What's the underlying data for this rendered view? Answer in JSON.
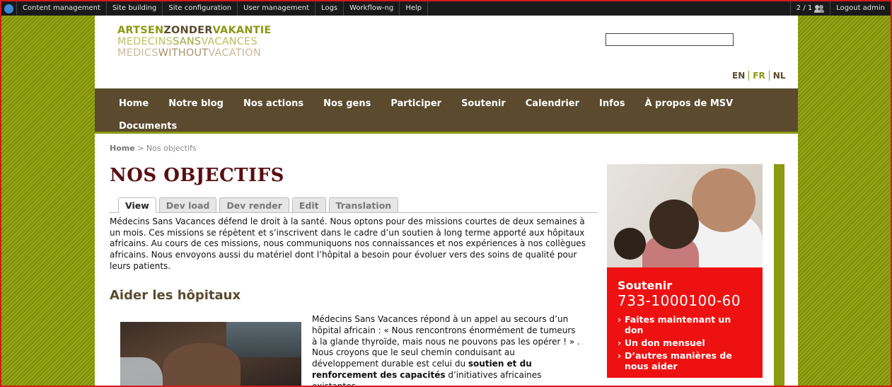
{
  "admin_bar": {
    "menu": [
      "Content management",
      "Site building",
      "Site configuration",
      "User management",
      "Logs",
      "Workflow-ng",
      "Help"
    ],
    "users_online": "2 / 1",
    "logout": "Logout admin"
  },
  "logo": {
    "line1_a": "ARTSEN",
    "line1_b": "ZONDER",
    "line1_c": "VAKANTIE",
    "line2_a": "MEDECINS",
    "line2_b": "SANS",
    "line2_c": "VACANCES",
    "line3_a": "MEDICS",
    "line3_b": "WITHOUT",
    "line3_c": "VACATION"
  },
  "search": {
    "value": ""
  },
  "languages": [
    {
      "label": "EN",
      "active": false
    },
    {
      "label": "FR",
      "active": true
    },
    {
      "label": "NL",
      "active": false
    }
  ],
  "nav": [
    "Home",
    "Notre blog",
    "Nos actions",
    "Nos gens",
    "Participer",
    "Soutenir",
    "Calendrier",
    "Infos",
    "À propos de MSV",
    "Documents"
  ],
  "breadcrumb": {
    "home": "Home",
    "separator": ">",
    "current": "Nos objectifs"
  },
  "page_title": "NOS OBJECTIFS",
  "tabs": [
    "View",
    "Dev load",
    "Dev render",
    "Edit",
    "Translation"
  ],
  "intro": "Médecins Sans Vacances défend le droit à la santé. Nous optons pour des missions courtes de deux semaines à un mois. Ces missions se répètent et s’inscrivent dans le cadre d’un soutien à long terme apporté aux hôpitaux africains. Au cours de ces missions, nous communiquons nos connaissances et nos expériences à nos collègues africains. Nous envoyons aussi du matériel dont l’hôpital a besoin pour évoluer vers des soins de qualité pour leurs patients.",
  "section_title": "Aider les hôpitaux",
  "body": {
    "text1": "Médecins Sans Vacances répond à un appel au secours d’un hôpital africain : « Nous rencontrons énormément de tumeurs à la glande thyroïde, mais nous ne pouvons pas les opérer ! » . Nous croyons que le seul chemin conduisant au développement durable est celui du ",
    "bold": "soutien et du renforcement des capacités",
    "text2": " d’initiatives africaines existantes."
  },
  "promo": {
    "title": "Soutenir",
    "account": "733-1000100-60",
    "links": [
      "Faites maintenant un don",
      "Un don mensuel",
      "D’autres manières de nous aider"
    ]
  },
  "colors": {
    "olive": "#8a9a12",
    "brown": "#5b4a2e",
    "title_red": "#5a0e12",
    "promo_red": "#ee1111"
  }
}
